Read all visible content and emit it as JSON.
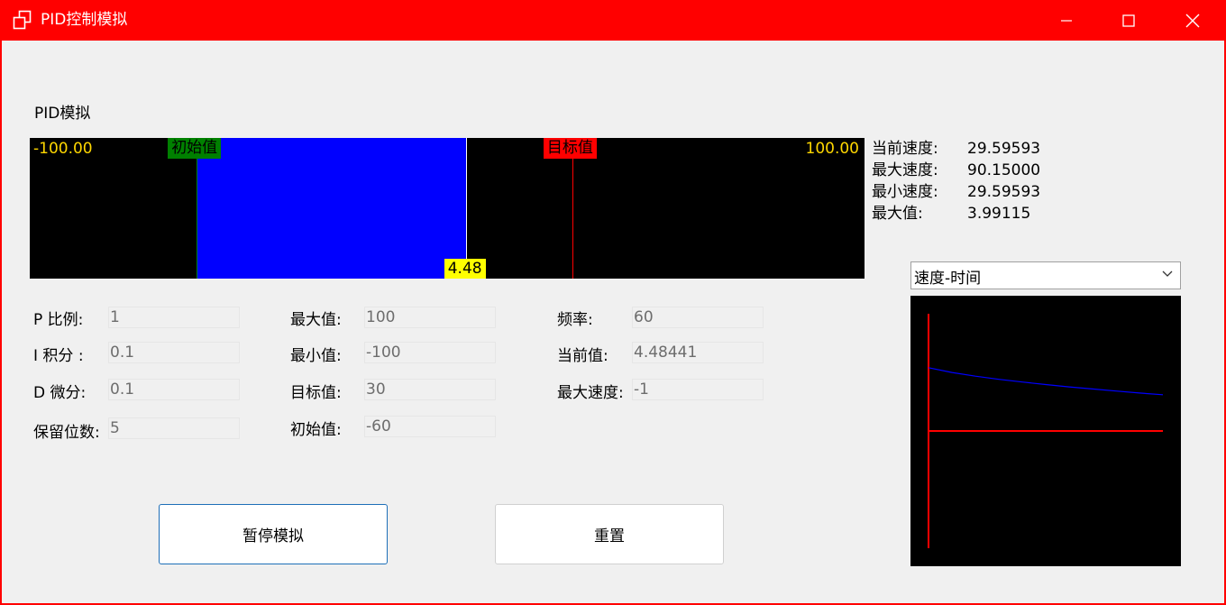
{
  "window": {
    "title": "PID控制模拟",
    "controls": [
      "minimize-icon",
      "maximize-icon",
      "close-icon"
    ],
    "title_bar_color": "#ff0000"
  },
  "section_label": "PID模拟",
  "progress_bar": {
    "min_label": "-100.00",
    "max_label": "100.00",
    "initial_tag": "初始值",
    "target_tag": "目标值",
    "current_tag": "4.48",
    "range": [
      -100,
      100
    ],
    "initial_value": -60,
    "target_value": 30,
    "current_value": 4.48,
    "colors": {
      "fill": "#0000ff",
      "initial_line": "#008000",
      "target_line": "#ff0000",
      "current_line": "#ffffff",
      "labels": "#ffd700"
    }
  },
  "stats": [
    {
      "key": "当前速度:",
      "value": "29.59593"
    },
    {
      "key": "最大速度:",
      "value": "90.15000"
    },
    {
      "key": "最小速度:",
      "value": "29.59593"
    },
    {
      "key": "最大值:",
      "value": "3.99115"
    }
  ],
  "params": {
    "col1": [
      {
        "label": "P 比例:",
        "value": "1"
      },
      {
        "label": "I 积分 :",
        "value": "0.1"
      },
      {
        "label": "D 微分:",
        "value": "0.1"
      },
      {
        "label": "保留位数:",
        "value": "5"
      }
    ],
    "col2": [
      {
        "label": "最大值:",
        "value": "100"
      },
      {
        "label": "最小值:",
        "value": "-100"
      },
      {
        "label": "目标值:",
        "value": "30"
      },
      {
        "label": "初始值:",
        "value": "-60"
      }
    ],
    "col3": [
      {
        "label": "频率:",
        "value": "60"
      },
      {
        "label": "当前值:",
        "value": "4.48441"
      },
      {
        "label": "最大速度:",
        "value": "-1"
      }
    ]
  },
  "buttons": {
    "pause_label": "暂停模拟",
    "reset_label": "重置"
  },
  "chart_selector": {
    "selected": "速度-时间"
  },
  "chart_data": {
    "type": "line",
    "title": "",
    "xlabel": "",
    "ylabel": "",
    "series": [
      {
        "color": "#0000ff",
        "x": [
          0,
          0.1,
          0.2,
          0.3,
          0.4,
          0.5,
          0.6,
          0.7,
          0.8,
          0.9,
          1.0
        ],
        "y": [
          0.6,
          0.555,
          0.52,
          0.49,
          0.464,
          0.44,
          0.418,
          0.398,
          0.379,
          0.36,
          0.344
        ]
      }
    ],
    "axis_color": "#ff0000",
    "grid": false
  }
}
